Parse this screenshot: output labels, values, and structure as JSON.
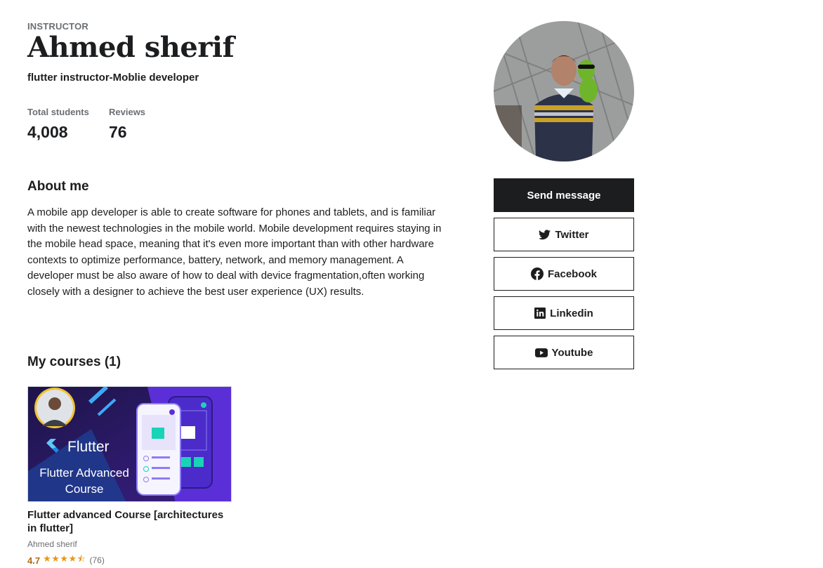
{
  "profile": {
    "eyebrow": "INSTRUCTOR",
    "name": "Ahmed sherif",
    "headline": "flutter instructor-Moblie developer"
  },
  "stats": {
    "students_label": "Total students",
    "students_value": "4,008",
    "reviews_label": "Reviews",
    "reviews_value": "76"
  },
  "about": {
    "title": "About me",
    "text": "A mobile app developer is able to create software for phones and tablets, and is familiar with the newest technologies in the mobile world. Mobile development requires staying in the mobile head space, meaning that it's even more important than with other hardware contexts to optimize performance, battery, network, and memory management. A developer must be also aware of how to deal with device fragmentation,often working closely with a designer to achieve the best user experience (UX) results."
  },
  "courses": {
    "title": "My courses (1)",
    "items": [
      {
        "thumb_brand": "Flutter",
        "thumb_line1": "Flutter Advanced",
        "thumb_line2": "Course",
        "title": "Flutter advanced Course [architectures in flutter]",
        "author": "Ahmed sherif",
        "rating": "4.7",
        "stars": "★★★★⯪",
        "count": "(76)"
      }
    ]
  },
  "actions": {
    "send_message": "Send message",
    "twitter": "Twitter",
    "facebook": "Facebook",
    "linkedin": "Linkedin",
    "youtube": "Youtube"
  },
  "icons": [
    "twitter-icon",
    "facebook-icon",
    "linkedin-icon",
    "youtube-icon"
  ],
  "colors": {
    "text": "#1c1d1f",
    "muted": "#6a6f73",
    "rating": "#b4690e",
    "star": "#e59819",
    "thumb_bg": "#2a1a5e",
    "thumb_accent": "#6c3cf0"
  }
}
